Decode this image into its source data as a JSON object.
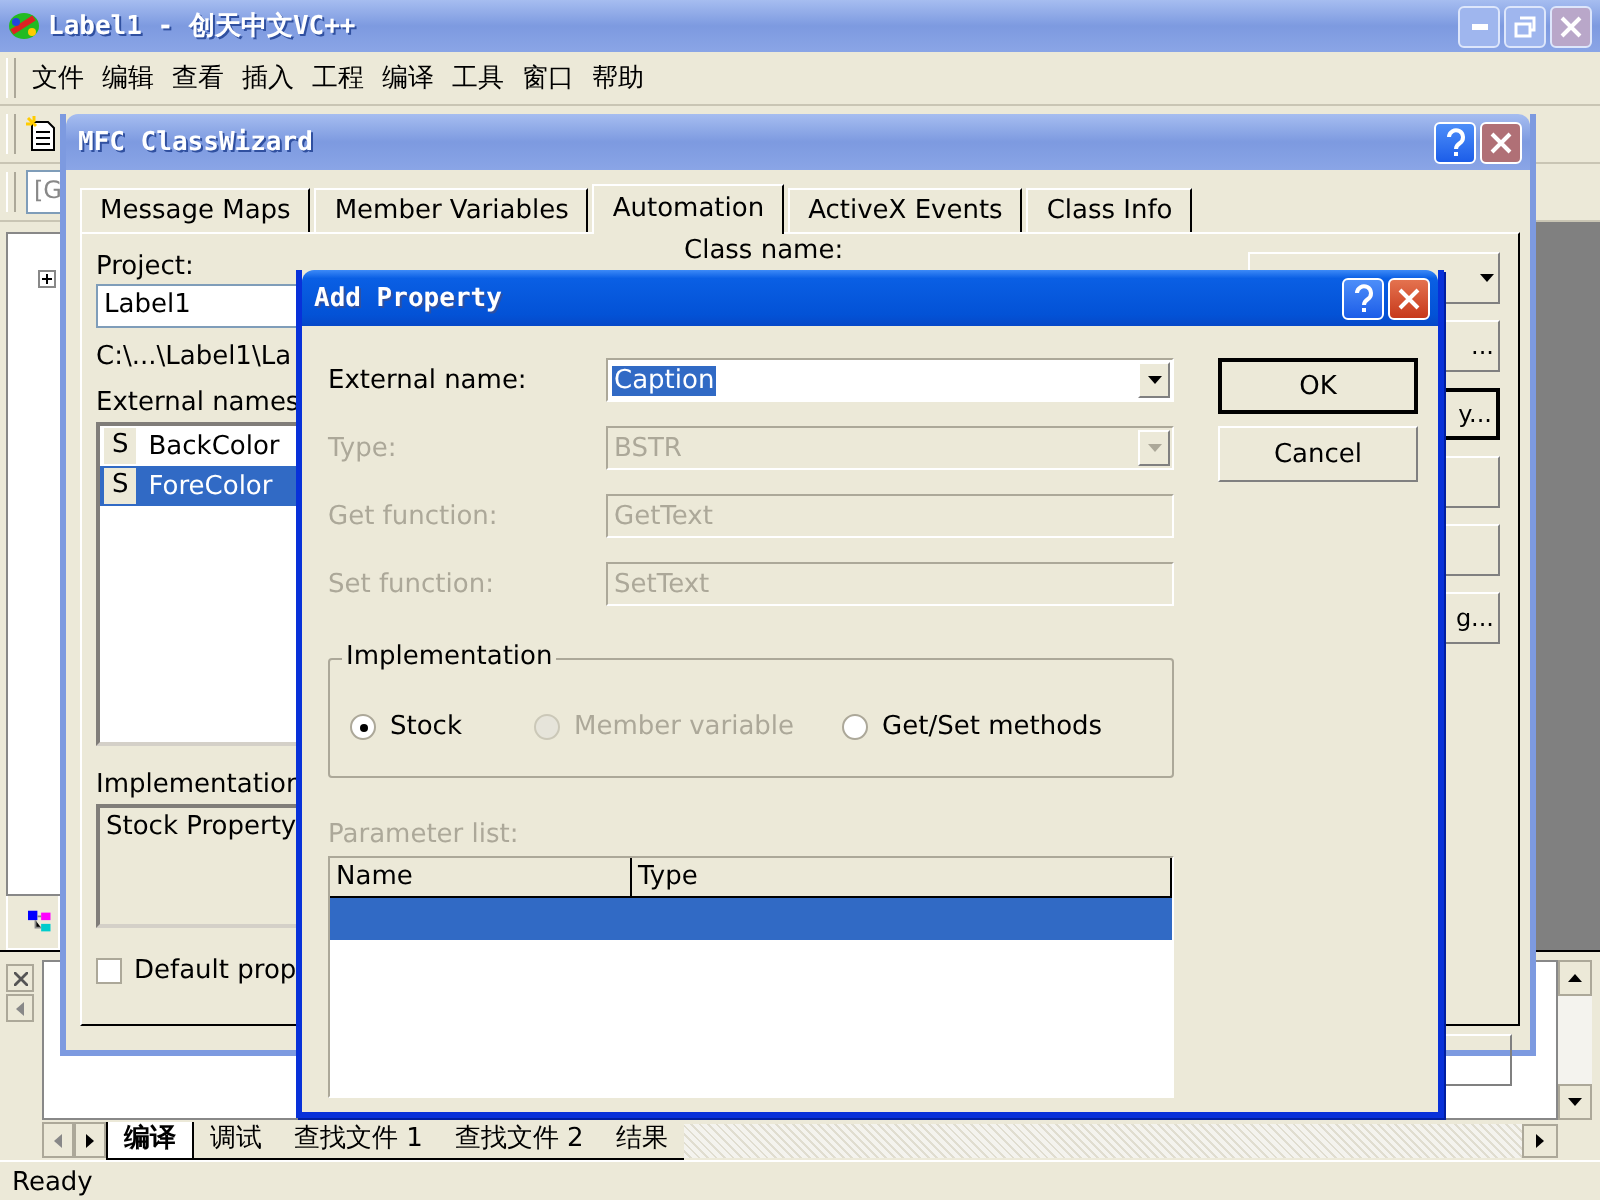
{
  "main_window": {
    "title": "Label1 - 创天中文VC++",
    "menu": [
      "文件",
      "编辑",
      "查看",
      "插入",
      "工程",
      "编译",
      "工具",
      "窗口",
      "帮助"
    ],
    "combo_text": "[G",
    "output_tabs": [
      {
        "label": "编译",
        "selected": true
      },
      {
        "label": "调试",
        "selected": false
      },
      {
        "label": "查找文件 1",
        "selected": false
      },
      {
        "label": "查找文件 2",
        "selected": false
      },
      {
        "label": "结果",
        "selected": false
      }
    ],
    "status_bar": "Ready"
  },
  "class_wizard": {
    "title": "MFC ClassWizard",
    "tabs": [
      {
        "label": "Message Maps",
        "selected": false
      },
      {
        "label": "Member Variables",
        "selected": false
      },
      {
        "label": "Automation",
        "selected": true
      },
      {
        "label": "ActiveX Events",
        "selected": false
      },
      {
        "label": "Class Info",
        "selected": false
      }
    ],
    "project_label": "Project:",
    "project": "Label1",
    "path": "C:\\...\\Label1\\La",
    "class_name_label": "Class name:",
    "external_names_label": "External names",
    "external_names": [
      {
        "type": "S",
        "name": "BackColor",
        "selected": false
      },
      {
        "type": "S",
        "name": "ForeColor",
        "selected": true
      }
    ],
    "implementation_label": "Implementation",
    "implementation": "Stock Property",
    "default_property": {
      "label": "Default prop",
      "checked": false
    },
    "side_buttons": [
      {
        "kind": "dropdown"
      },
      {
        "kind": "text",
        "label": "..."
      },
      {
        "kind": "text",
        "label": "y...",
        "default": true
      },
      {
        "kind": "plain"
      },
      {
        "kind": "plain"
      },
      {
        "kind": "text",
        "label": "g..."
      }
    ]
  },
  "add_property": {
    "title": "Add Property",
    "fields": [
      {
        "kind": "combo",
        "label": "External name:",
        "value": "Caption",
        "disabled": false,
        "text_selected": true
      },
      {
        "kind": "combo",
        "label": "Type:",
        "value": "BSTR",
        "disabled": true
      },
      {
        "kind": "text",
        "label": "Get function:",
        "value": "GetText",
        "disabled": true
      },
      {
        "kind": "text",
        "label": "Set function:",
        "value": "SetText",
        "disabled": true
      }
    ],
    "buttons": [
      {
        "label": "OK",
        "default": true
      },
      {
        "label": "Cancel",
        "default": false
      }
    ],
    "implementation": {
      "label": "Implementation",
      "options": [
        {
          "label": "Stock",
          "selected": true,
          "disabled": false
        },
        {
          "label": "Member variable",
          "selected": false,
          "disabled": true
        },
        {
          "label": "Get/Set methods",
          "selected": false,
          "disabled": false
        }
      ]
    },
    "parameter_list": {
      "label": "Parameter list:",
      "disabled": true,
      "columns": [
        "Name",
        "Type"
      ],
      "rows": [
        {
          "selected": true
        }
      ]
    }
  }
}
